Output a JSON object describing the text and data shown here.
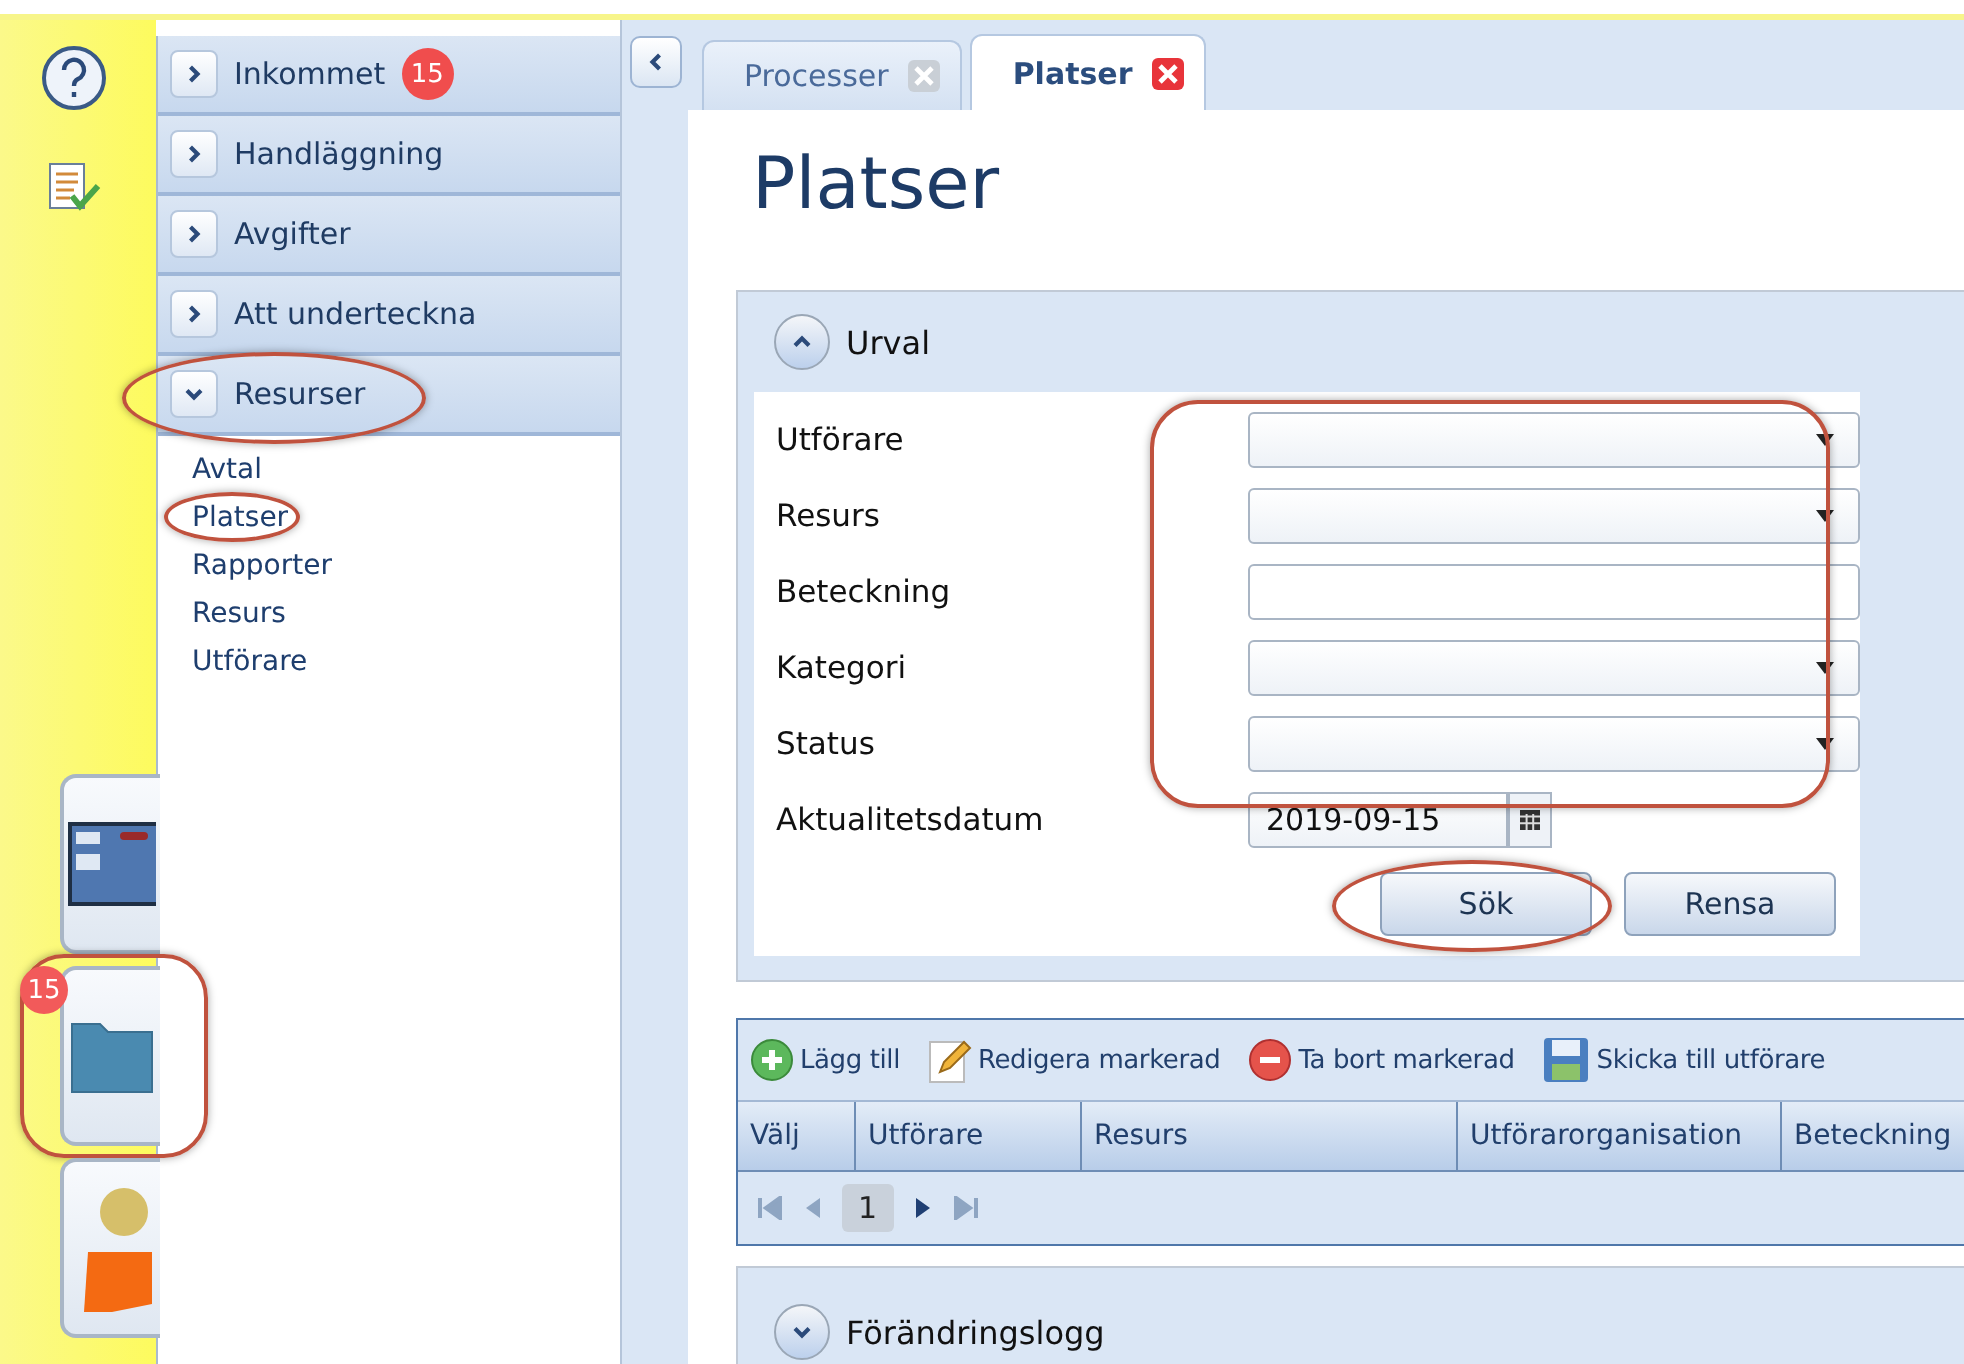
{
  "dock": {
    "items": [
      {
        "kind": "window",
        "highlighted": false
      },
      {
        "kind": "folder",
        "badge": "15",
        "highlighted": true
      },
      {
        "kind": "person",
        "highlighted": false
      }
    ]
  },
  "nav": {
    "sections": [
      {
        "label": "Inkommet",
        "badge": "15",
        "expanded": false,
        "highlighted": false
      },
      {
        "label": "Handläggning",
        "expanded": false,
        "highlighted": false
      },
      {
        "label": "Avgifter",
        "expanded": false,
        "highlighted": false
      },
      {
        "label": "Att underteckna",
        "expanded": false,
        "highlighted": false
      },
      {
        "label": "Resurser",
        "expanded": true,
        "highlighted": true,
        "children": [
          {
            "label": "Avtal",
            "highlighted": false
          },
          {
            "label": "Platser",
            "highlighted": true
          },
          {
            "label": "Rapporter",
            "highlighted": false
          },
          {
            "label": "Resurs",
            "highlighted": false
          },
          {
            "label": "Utförare",
            "highlighted": false
          }
        ]
      }
    ]
  },
  "tabs": [
    {
      "label": "Processer",
      "selected": false
    },
    {
      "label": "Platser",
      "selected": true
    }
  ],
  "page": {
    "title": "Platser"
  },
  "filter": {
    "title": "Urval",
    "expanded": true,
    "fields_highlighted": true,
    "fields": [
      {
        "label": "Utförare",
        "kind": "dropdown"
      },
      {
        "label": "Resurs",
        "kind": "dropdown"
      },
      {
        "label": "Beteckning",
        "kind": "text"
      },
      {
        "label": "Kategori",
        "kind": "dropdown"
      },
      {
        "label": "Status",
        "kind": "dropdown"
      },
      {
        "label": "Aktualitetsdatum",
        "kind": "date",
        "value": "2019-09-15"
      }
    ],
    "buttons": [
      {
        "label": "Sök",
        "highlighted": true
      },
      {
        "label": "Rensa",
        "highlighted": false
      }
    ]
  },
  "toolbar": [
    {
      "label": "Lägg till",
      "kind": "add"
    },
    {
      "label": "Redigera markerad",
      "kind": "edit"
    },
    {
      "label": "Ta bort markerad",
      "kind": "delete"
    },
    {
      "label": "Skicka till utförare",
      "kind": "save"
    }
  ],
  "table": {
    "columns": [
      "Välj",
      "Utförare",
      "Resurs",
      "Utförarorganisation",
      "Beteckning"
    ]
  },
  "pager": {
    "page": "1"
  },
  "changelog": {
    "title": "Förändringslogg",
    "expanded": false
  }
}
